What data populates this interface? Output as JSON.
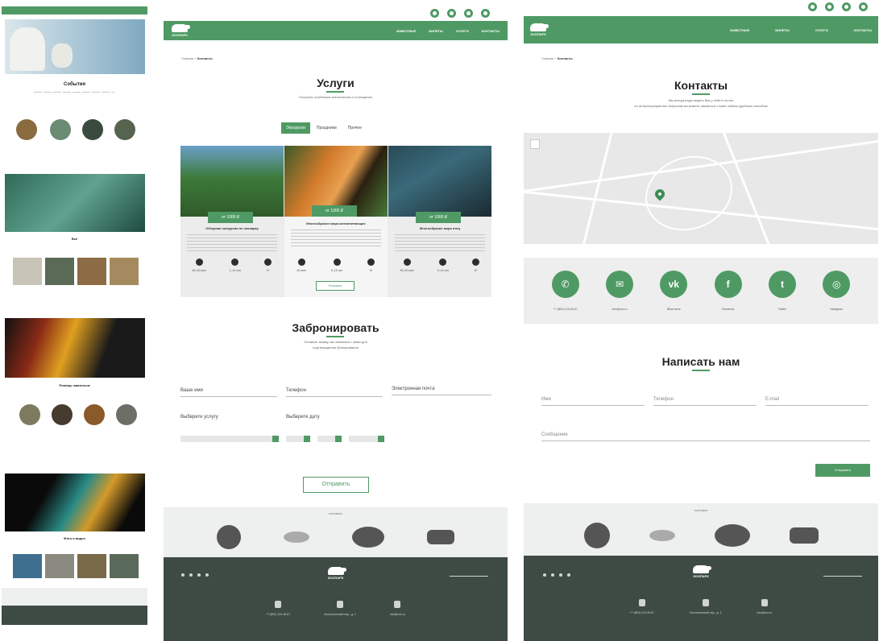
{
  "colors": {
    "accent": "#4f9a64",
    "footer": "#3e4b44",
    "gray_band": "#eeeeee"
  },
  "overview": {
    "sections": [
      "События",
      "Всё",
      "Помощь животным",
      "Фото и видео"
    ]
  },
  "services_page": {
    "logo_word": "ЗООПАРК",
    "nav": [
      "ЖИВОТНЫЕ",
      "БИЛЕТЫ",
      "УСЛУГИ",
      "КОНТАКТЫ"
    ],
    "breadcrumb_home": "Главная",
    "breadcrumb_current": "Контакты",
    "title": "Услуги",
    "subtitle": "Получите особенные впечатления от посещения",
    "tabs": [
      "Экскурсии",
      "Праздники",
      "Прочее"
    ],
    "cards": [
      {
        "price": "от 1000 ₽",
        "title": "Обзорная экскурсия по зоопарку",
        "stats": [
          "60–90 мин",
          "1–10 чел",
          "3+"
        ]
      },
      {
        "price": "от 1000 ₽",
        "title": "Многообразие мира млекопитающих",
        "stats": [
          "60 мин",
          "5–15 чел",
          "6+"
        ]
      },
      {
        "price": "от 1000 ₽",
        "title": "Многообразие мира птиц",
        "stats": [
          "60–90 мин",
          "5–15 чел",
          "6+"
        ]
      }
    ],
    "more_button": "Показать",
    "booking_title": "Забронировать",
    "booking_subtitle_1": "Оставьте заявку, мы свяжемся с вами для",
    "booking_subtitle_2": "подтверждения бронирования",
    "fields": {
      "name": "Ваше имя",
      "phone": "Телефон",
      "email": "Электронная почта",
      "service": "Выберете услугу",
      "date": "Выберете дату"
    },
    "send_button": "Отправить",
    "partners_label": "ПАРТНЁРЫ",
    "footer_logo": "ЗООПАРК",
    "footer_items": [
      "+7 (800) 123-45-67",
      "Зоологический пер., д. 1",
      "info@zoo.ru"
    ]
  },
  "contacts_page": {
    "logo_word": "ЗООПАРК",
    "nav": [
      "ЖИВОТНЫЕ",
      "БИЛЕТЫ",
      "УСЛУГИ",
      "КОНТАКТЫ"
    ],
    "breadcrumb_home": "Главная",
    "breadcrumb_current": "Контакты",
    "title": "Контакты",
    "subtitle_1": "Мы всегда рады видеть Вас у себя в гостях",
    "subtitle_2": "по интересующим вас вопросам вы можете связаться с нами любым удобным способом",
    "contacts": [
      {
        "glyph": "✆",
        "label": "+7 (800) 123-45-67"
      },
      {
        "glyph": "✉",
        "label": "info@zoo.ru"
      },
      {
        "glyph": "vk",
        "label": "ВКонтакте"
      },
      {
        "glyph": "f",
        "label": "Facebook"
      },
      {
        "glyph": "t",
        "label": "Twitter"
      },
      {
        "glyph": "◎",
        "label": "Instagram"
      }
    ],
    "form_title": "Написать нам",
    "fields": {
      "name": "Имя",
      "phone": "Телефон",
      "email": "E-mail",
      "message": "Сообщение"
    },
    "send_button": "Отправить",
    "partners_label": "ПАРТНЁРЫ",
    "footer_logo": "ЗООПАРК"
  }
}
